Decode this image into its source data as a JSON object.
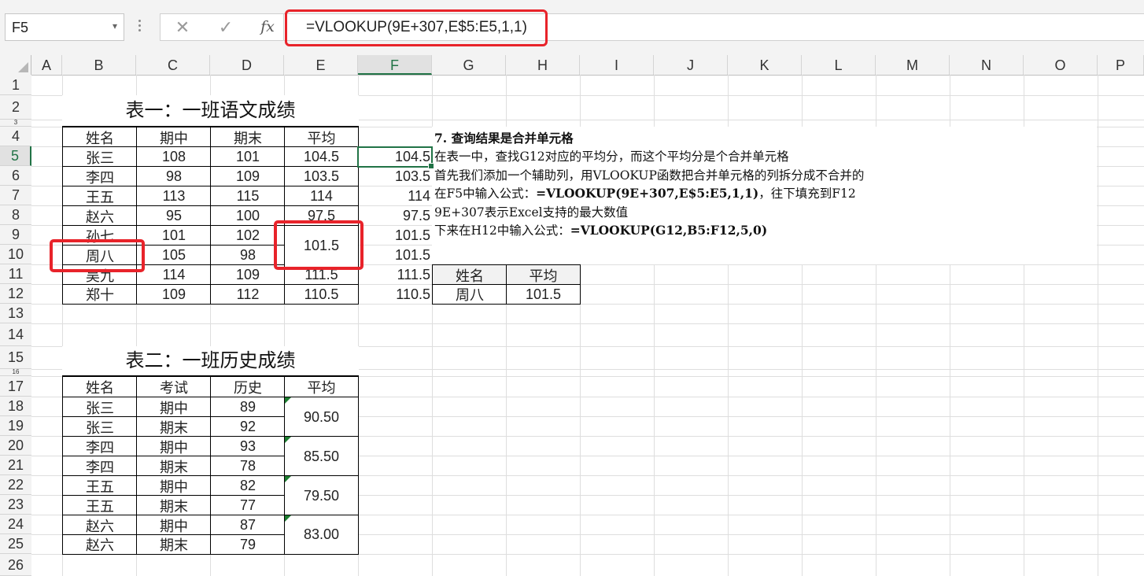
{
  "formula_bar": {
    "name_box": "F5",
    "cancel": "✕",
    "enter": "✓",
    "fx": "fx",
    "formula": "=VLOOKUP(9E+307,E$5:E5,1,1)"
  },
  "columns": [
    "A",
    "B",
    "C",
    "D",
    "E",
    "F",
    "G",
    "H",
    "I",
    "J",
    "K",
    "L",
    "M",
    "N",
    "O",
    "P"
  ],
  "rows": [
    "1",
    "2",
    "3",
    "4",
    "5",
    "6",
    "7",
    "8",
    "9",
    "10",
    "11",
    "12",
    "13",
    "14",
    "15",
    "16",
    "17",
    "18",
    "19",
    "20",
    "21",
    "22",
    "23",
    "24",
    "25",
    "26"
  ],
  "table1": {
    "title": "表一：一班语文成绩",
    "headers": [
      "姓名",
      "期中",
      "期末",
      "平均"
    ],
    "rows": [
      [
        "张三",
        "108",
        "101",
        "104.5"
      ],
      [
        "李四",
        "98",
        "109",
        "103.5"
      ],
      [
        "王五",
        "113",
        "115",
        "114"
      ],
      [
        "赵六",
        "95",
        "100",
        "97.5"
      ],
      [
        "孙七",
        "101",
        "102",
        ""
      ],
      [
        "周八",
        "105",
        "98",
        ""
      ],
      [
        "吴九",
        "114",
        "109",
        "111.5"
      ],
      [
        "郑十",
        "109",
        "112",
        "110.5"
      ]
    ],
    "merged_avg": "101.5"
  },
  "helper_col": [
    "104.5",
    "103.5",
    "114",
    "97.5",
    "101.5",
    "101.5",
    "111.5",
    "110.5"
  ],
  "lookup": {
    "headers": [
      "姓名",
      "平均"
    ],
    "name": "周八",
    "avg": "101.5"
  },
  "note": {
    "line1": "7. 查询结果是合并单元格",
    "line2": "在表一中，查找G12对应的平均分，而这个平均分是个合并单元格",
    "line3": "首先我们添加一个辅助列，用VLOOKUP函数把合并单元格的列拆分成不合并的",
    "line4a": "在F5中输入公式：",
    "line4b": "=VLOOKUP(9E+307,E$5:E5,1,1)",
    "line4c": "，往下填充到F12",
    "line5": "9E+307表示Excel支持的最大数值",
    "line6a": "下来在H12中输入公式：",
    "line6b": "=VLOOKUP(G12,B5:F12,5,0)"
  },
  "table2": {
    "title": "表二：一班历史成绩",
    "headers": [
      "姓名",
      "考试",
      "历史",
      "平均"
    ],
    "rows": [
      [
        "张三",
        "期中",
        "89"
      ],
      [
        "张三",
        "期末",
        "92"
      ],
      [
        "李四",
        "期中",
        "93"
      ],
      [
        "李四",
        "期末",
        "78"
      ],
      [
        "王五",
        "期中",
        "82"
      ],
      [
        "王五",
        "期末",
        "77"
      ],
      [
        "赵六",
        "期中",
        "87"
      ],
      [
        "赵六",
        "期末",
        "79"
      ]
    ],
    "avgs": [
      "90.50",
      "85.50",
      "79.50",
      "83.00"
    ]
  },
  "colors": {
    "accent_green": "#217346",
    "highlight_red": "#e8232a"
  }
}
